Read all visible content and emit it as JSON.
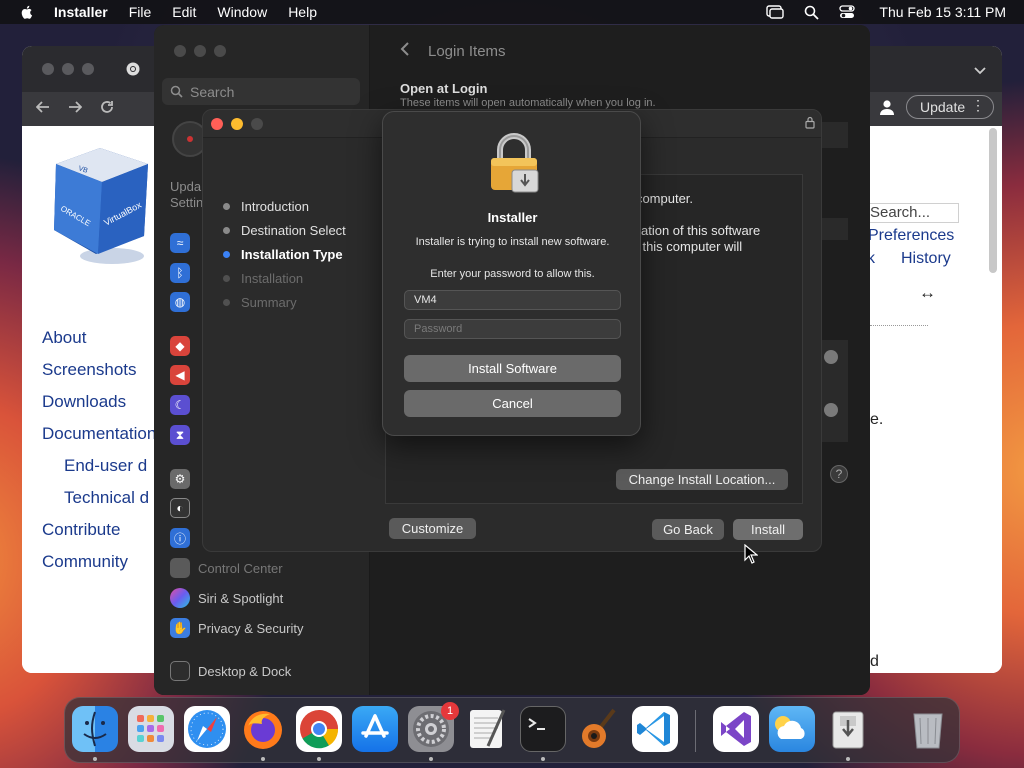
{
  "menubar": {
    "app_name": "Installer",
    "items": [
      "File",
      "Edit",
      "Window",
      "Help"
    ],
    "clock": "Thu Feb 15  3:11 PM"
  },
  "browser": {
    "update_label": "Update",
    "search_placeholder": "Search...",
    "nav_links": [
      "About",
      "Screenshots",
      "Downloads",
      "Documentation",
      "End-user d",
      "Technical d",
      "Contribute",
      "Community"
    ],
    "right_links": {
      "preferences": "Preferences",
      "partial": "k",
      "history": "History"
    },
    "arrow_glyph": "↔",
    "fragments": {
      "e": "e.",
      "d": "d"
    }
  },
  "settings": {
    "search_placeholder": "Search",
    "clipped_label": "Upda\nSettin",
    "sidebar_items": [
      {
        "label": "Control Center",
        "color": "#5a5a5a"
      },
      {
        "label": "Siri & Spotlight",
        "color": "#9b4fd1"
      },
      {
        "label": "Privacy & Security",
        "color": "#3b7de0"
      },
      {
        "label": "Desktop & Dock",
        "color": "#2d2d2d"
      }
    ],
    "page_title": "Login Items",
    "section_title": "Open at Login",
    "section_sub": "These items will open automatically when you log in."
  },
  "installer": {
    "steps": [
      {
        "label": "Introduction",
        "state": "done"
      },
      {
        "label": "Destination Select",
        "state": "done"
      },
      {
        "label": "Installation Type",
        "state": "active"
      },
      {
        "label": "Installation",
        "state": "pending"
      },
      {
        "label": "Summary",
        "state": "pending"
      }
    ],
    "pane_line1": "r computer.",
    "pane_line2": "allation of this software",
    "pane_line3": "of this computer will",
    "change_location": "Change Install Location...",
    "customize": "Customize",
    "go_back": "Go Back",
    "install": "Install"
  },
  "auth": {
    "title": "Installer",
    "message": "Installer is trying to install new software.",
    "prompt": "Enter your password to allow this.",
    "username": "VM4",
    "password_placeholder": "Password",
    "install_button": "Install Software",
    "cancel_button": "Cancel"
  },
  "dock": {
    "items": [
      "Finder",
      "Launchpad",
      "Safari",
      "Firefox",
      "Chrome",
      "App Store",
      "System Settings",
      "TextEdit",
      "Terminal",
      "GarageBand",
      "Visual Studio Code",
      "Visual Studio",
      "iCloud",
      "Installer",
      "Trash"
    ],
    "settings_badge": "1"
  }
}
